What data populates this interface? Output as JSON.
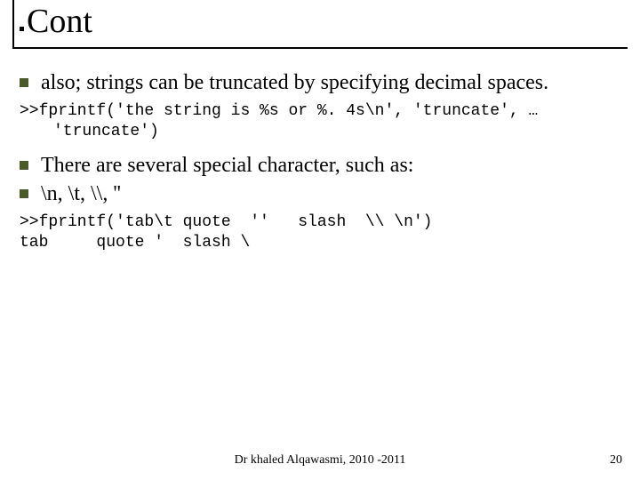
{
  "title": "Cont",
  "bullets": {
    "b1": "also; strings can be truncated by specifying decimal spaces.",
    "b2": "There are several special character, such as:",
    "b3": "\\n, \\t, \\\\, '' "
  },
  "code": {
    "c1a": ">>fprintf('the string is %s or %. 4s\\n', 'truncate', …",
    "c1b": "'truncate')",
    "c2a": ">>fprintf('tab\\t quote  ''   slash  \\\\ \\n')",
    "c2b": "tab     quote '  slash \\"
  },
  "footer": "Dr khaled Alqawasmi, 2010 -2011",
  "page": "20"
}
